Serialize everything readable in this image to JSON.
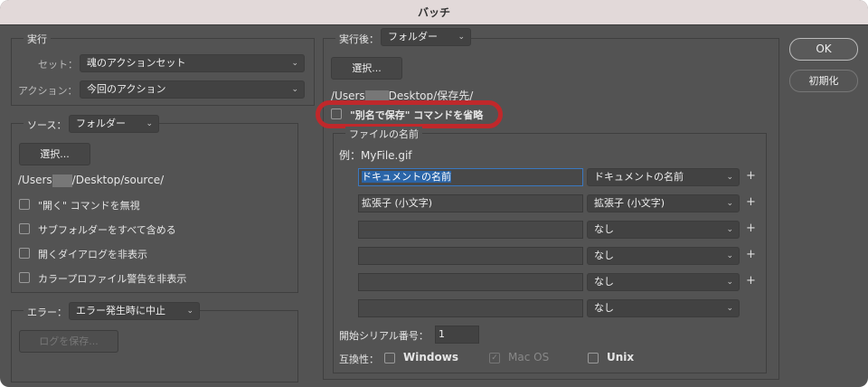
{
  "window": {
    "title": "バッチ"
  },
  "play": {
    "legend": "実行",
    "set_label": "セット：",
    "set_value": "魂のアクションセット",
    "action_label": "アクション：",
    "action_value": "今回のアクション"
  },
  "source": {
    "label": "ソース：",
    "value": "フォルダー",
    "choose": "選択...",
    "path_a": "/Users",
    "path_b": "/Desktop/source/",
    "checks": [
      {
        "label": "\"開く\" コマンドを無視",
        "checked": false
      },
      {
        "label": "サブフォルダーをすべて含める",
        "checked": false
      },
      {
        "label": "開くダイアログを非表示",
        "checked": false
      },
      {
        "label": "カラープロファイル警告を非表示",
        "checked": false
      }
    ]
  },
  "error": {
    "label": "エラー：",
    "value": "エラー発生時に中止",
    "save_log": "ログを保存..."
  },
  "destination": {
    "label": "実行後：",
    "value": "フォルダー",
    "choose": "選択...",
    "path_a": "/Users",
    "path_b": "Desktop/保存先/",
    "override_save_as": {
      "label": "\"別名で保存\" コマンドを省略",
      "checked": false,
      "annotation_color": "#c0282b"
    }
  },
  "file_naming": {
    "legend": "ファイルの名前",
    "example": "例：MyFile.gif",
    "rows": [
      {
        "text": "ドキュメントの名前",
        "select": "ドキュメントの名前",
        "plus": "+"
      },
      {
        "text": "拡張子 (小文字)",
        "select": "拡張子 (小文字)",
        "plus": "+"
      },
      {
        "text": "",
        "select": "なし",
        "plus": "+"
      },
      {
        "text": "",
        "select": "なし",
        "plus": "+"
      },
      {
        "text": "",
        "select": "なし",
        "plus": "+"
      },
      {
        "text": "",
        "select": "なし",
        "plus": ""
      }
    ],
    "serial_label": "開始シリアル番号：",
    "serial_value": "1",
    "compat_label": "互換性：",
    "compat": [
      {
        "label": "Windows",
        "checked": false,
        "enabled": true
      },
      {
        "label": "Mac OS",
        "checked": true,
        "enabled": false
      },
      {
        "label": "Unix",
        "checked": false,
        "enabled": true
      }
    ]
  },
  "buttons": {
    "ok": "OK",
    "reset": "初期化"
  }
}
